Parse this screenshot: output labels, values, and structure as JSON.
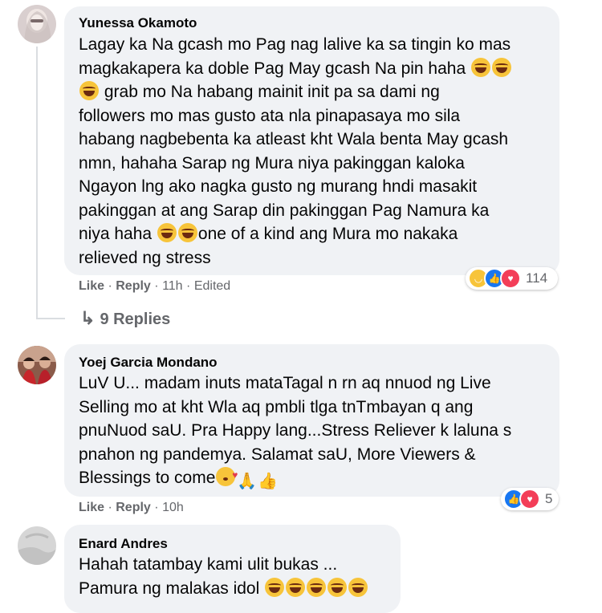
{
  "comments": [
    {
      "author": "Yunessa Okamoto",
      "lines": [
        "Lagay ka Na gcash mo Pag nag lalive ka sa tingin ko mas",
        "magkakapera ka doble Pag May gcash Na pin haha",
        "grab mo Na habang mainit init pa sa dami ng",
        "followers mo mas gusto ata nla pinapasaya mo sila",
        "habang nagbebenta ka atleast kht Wala benta May gcash",
        "nmn, hahaha Sarap ng Mura niya pakinggan kaloka",
        "Ngayon lng ako nagka gusto ng murang hndi masakit",
        "pakinggan at ang Sarap din pakinggan Pag Namura ka",
        "niya haha",
        "one of a kind ang Mura mo nakaka",
        "relieved ng stress"
      ],
      "like": "Like",
      "reply": "Reply",
      "time": "11h",
      "edited": "Edited",
      "reaction_count": "114",
      "replies_label": "9 Replies"
    },
    {
      "author": "Yoej Garcia Mondano",
      "lines": [
        "LuV U... madam inuts mataTagal n rn aq nnuod ng Live",
        "Selling mo at kht Wla aq pmbli tlga tnTmbayan q ang",
        "pnuNuod saU. Pra Happy lang...Stress Reliever k laluna s",
        "pnahon ng pandemya. Salamat saU, More Viewers &",
        "Blessings to come"
      ],
      "like": "Like",
      "reply": "Reply",
      "time": "10h",
      "reaction_count": "5"
    },
    {
      "author": "Enard Andres",
      "lines": [
        "Hahah tatambay kami ulit bukas ...",
        "Pamura ng malakas idol"
      ]
    }
  ],
  "separator": "·",
  "icons": [
    "laugh-emoji-icon",
    "kiss-emoji-icon",
    "praying-hands-icon",
    "thumbs-up-icon",
    "reply-arrow-icon",
    "haha-reaction-icon",
    "like-reaction-icon",
    "love-reaction-icon"
  ],
  "colors": {
    "bubble": "#f0f2f5",
    "secondary_text": "#65676b",
    "like_blue": "#1877f2",
    "love_red": "#f33e58"
  }
}
